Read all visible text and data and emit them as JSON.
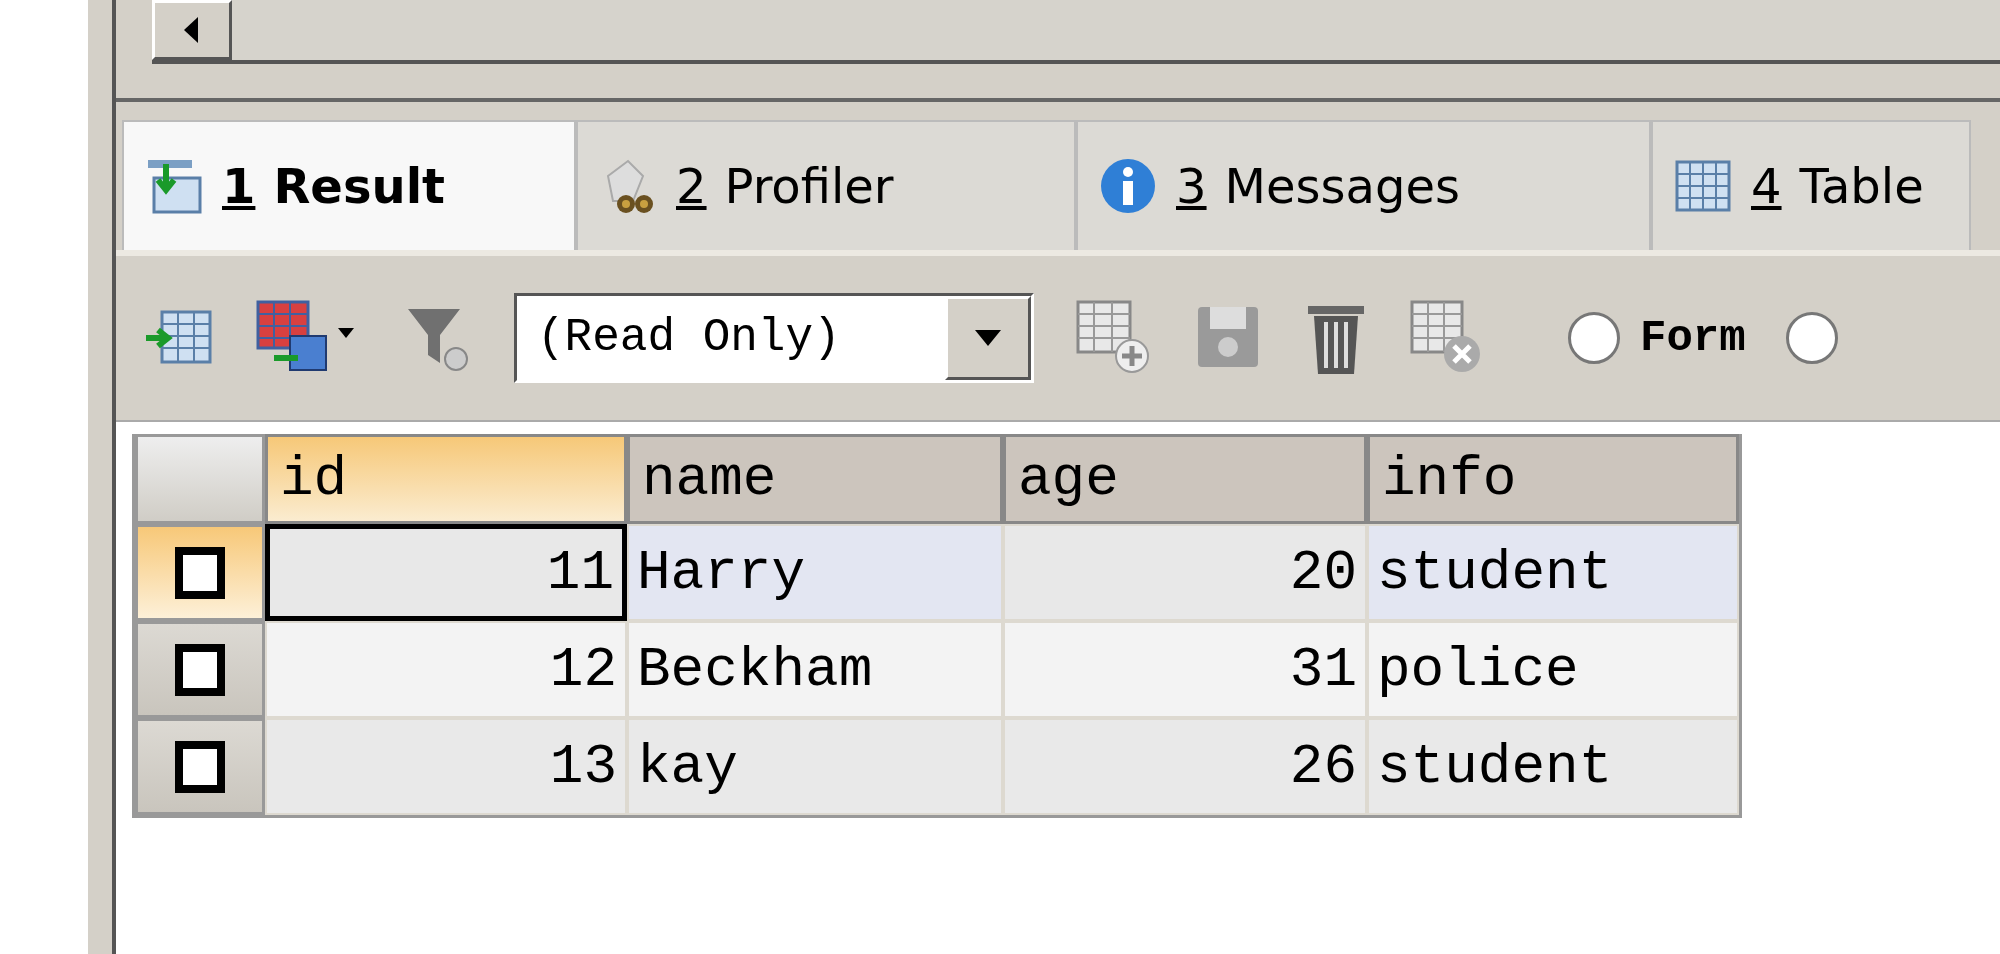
{
  "tabs": [
    {
      "number": "1",
      "label": "Result",
      "selected": true
    },
    {
      "number": "2",
      "label": "Profiler",
      "selected": false
    },
    {
      "number": "3",
      "label": "Messages",
      "selected": false
    },
    {
      "number": "4",
      "label": "Table",
      "selected": false
    }
  ],
  "toolbar": {
    "mode_dropdown": {
      "value": "(Read Only)"
    },
    "view_modes": [
      {
        "label": "Form",
        "selected": false
      },
      {
        "selected": false
      }
    ]
  },
  "grid": {
    "columns": [
      {
        "label": "id",
        "selected": true
      },
      {
        "label": "name",
        "selected": false
      },
      {
        "label": "age",
        "selected": false
      },
      {
        "label": "info",
        "selected": false
      }
    ],
    "rows": [
      {
        "checked": false,
        "selected": true,
        "cells": [
          "11",
          "Harry",
          "20",
          "student"
        ]
      },
      {
        "checked": false,
        "selected": false,
        "cells": [
          "12",
          "Beckham",
          "31",
          "police"
        ]
      },
      {
        "checked": false,
        "selected": false,
        "cells": [
          "13",
          "kay",
          "26",
          "student"
        ]
      }
    ]
  }
}
